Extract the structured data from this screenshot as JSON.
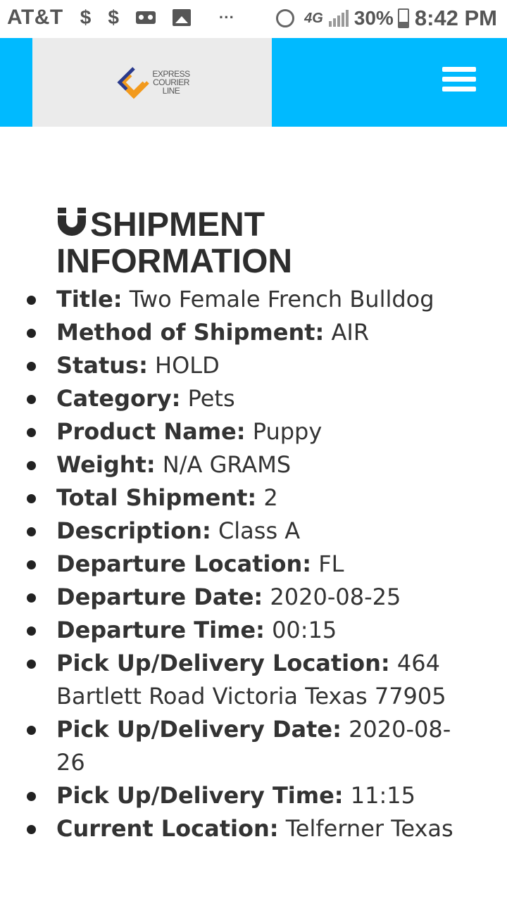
{
  "status_bar": {
    "carrier": "AT&T",
    "dollar_a": "$",
    "dollar_b": "$",
    "more": "···",
    "network": "4G",
    "battery": "30%",
    "time": "8:42 PM"
  },
  "header": {
    "logo_line1": "EXPRESS",
    "logo_line2": "COURIER",
    "logo_line3": "LINE",
    "accent_color": "#00baff"
  },
  "section": {
    "title_line1": "SHIPMENT",
    "title_line2": "INFORMATION"
  },
  "fields": [
    {
      "label": "Title:",
      "value": "Two Female French Bulldog"
    },
    {
      "label": "Method of Shipment:",
      "value": "AIR"
    },
    {
      "label": "Status:",
      "value": "HOLD"
    },
    {
      "label": "Category:",
      "value": "Pets"
    },
    {
      "label": "Product Name:",
      "value": "Puppy"
    },
    {
      "label": "Weight:",
      "value": "N/A GRAMS"
    },
    {
      "label": "Total Shipment:",
      "value": "2"
    },
    {
      "label": "Description:",
      "value": "Class A"
    },
    {
      "label": "Departure Location:",
      "value": "FL"
    },
    {
      "label": "Departure Date:",
      "value": "2020-08-25"
    },
    {
      "label": "Departure Time:",
      "value": "00:15"
    },
    {
      "label": "Pick Up/Delivery Location:",
      "value": "464 Bartlett Road Victoria Texas 77905"
    },
    {
      "label": "Pick Up/Delivery Date:",
      "value": "2020-08-26"
    },
    {
      "label": "Pick Up/Delivery Time:",
      "value": "11:15"
    },
    {
      "label": "Current Location:",
      "value": "Telferner Texas"
    }
  ]
}
